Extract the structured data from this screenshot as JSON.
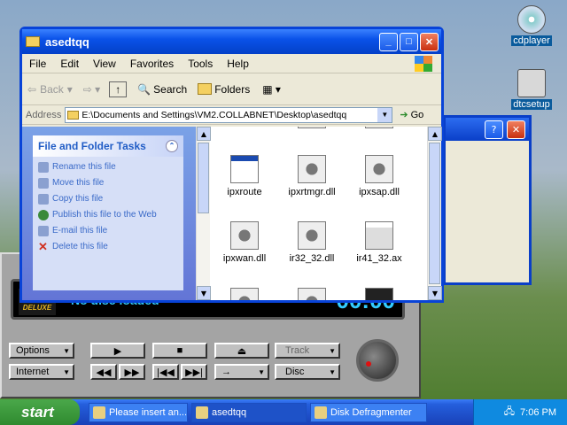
{
  "desktop": {
    "icons": [
      {
        "label": "cdplayer"
      },
      {
        "label": "dtcsetup"
      }
    ]
  },
  "cdplayer": {
    "logo": "CD",
    "logo_sub": "DELUXE",
    "status": "No disc loaded",
    "time": "00:00",
    "buttons": {
      "options": "Options",
      "internet": "Internet",
      "track": "Track",
      "disc": "Disc"
    }
  },
  "explorer": {
    "title": "asedtqq",
    "menu": [
      "File",
      "Edit",
      "View",
      "Favorites",
      "Tools",
      "Help"
    ],
    "toolbar": {
      "back": "Back",
      "search": "Search",
      "folders": "Folders"
    },
    "address": {
      "label": "Address",
      "value": "E:\\Documents and Settings\\VM2.COLLABNET\\Desktop\\asedtqq",
      "go": "Go"
    },
    "tasks": {
      "header": "File and Folder Tasks",
      "items": [
        "Rename this file",
        "Move this file",
        "Copy this file",
        "Publish this file to the Web",
        "E-mail this file",
        "Delete this file"
      ]
    },
    "files": [
      {
        "name": "ipxroute"
      },
      {
        "name": "ipxrtmgr.dll"
      },
      {
        "name": "ipxsap.dll"
      },
      {
        "name": "ipxwan.dll"
      },
      {
        "name": "ir32_32.dll"
      },
      {
        "name": "ir41_32.ax"
      }
    ]
  },
  "taskbar": {
    "start": "start",
    "items": [
      "Please insert an...",
      "asedtqq",
      "Disk Defragmenter"
    ],
    "clock": "7:06 PM"
  }
}
